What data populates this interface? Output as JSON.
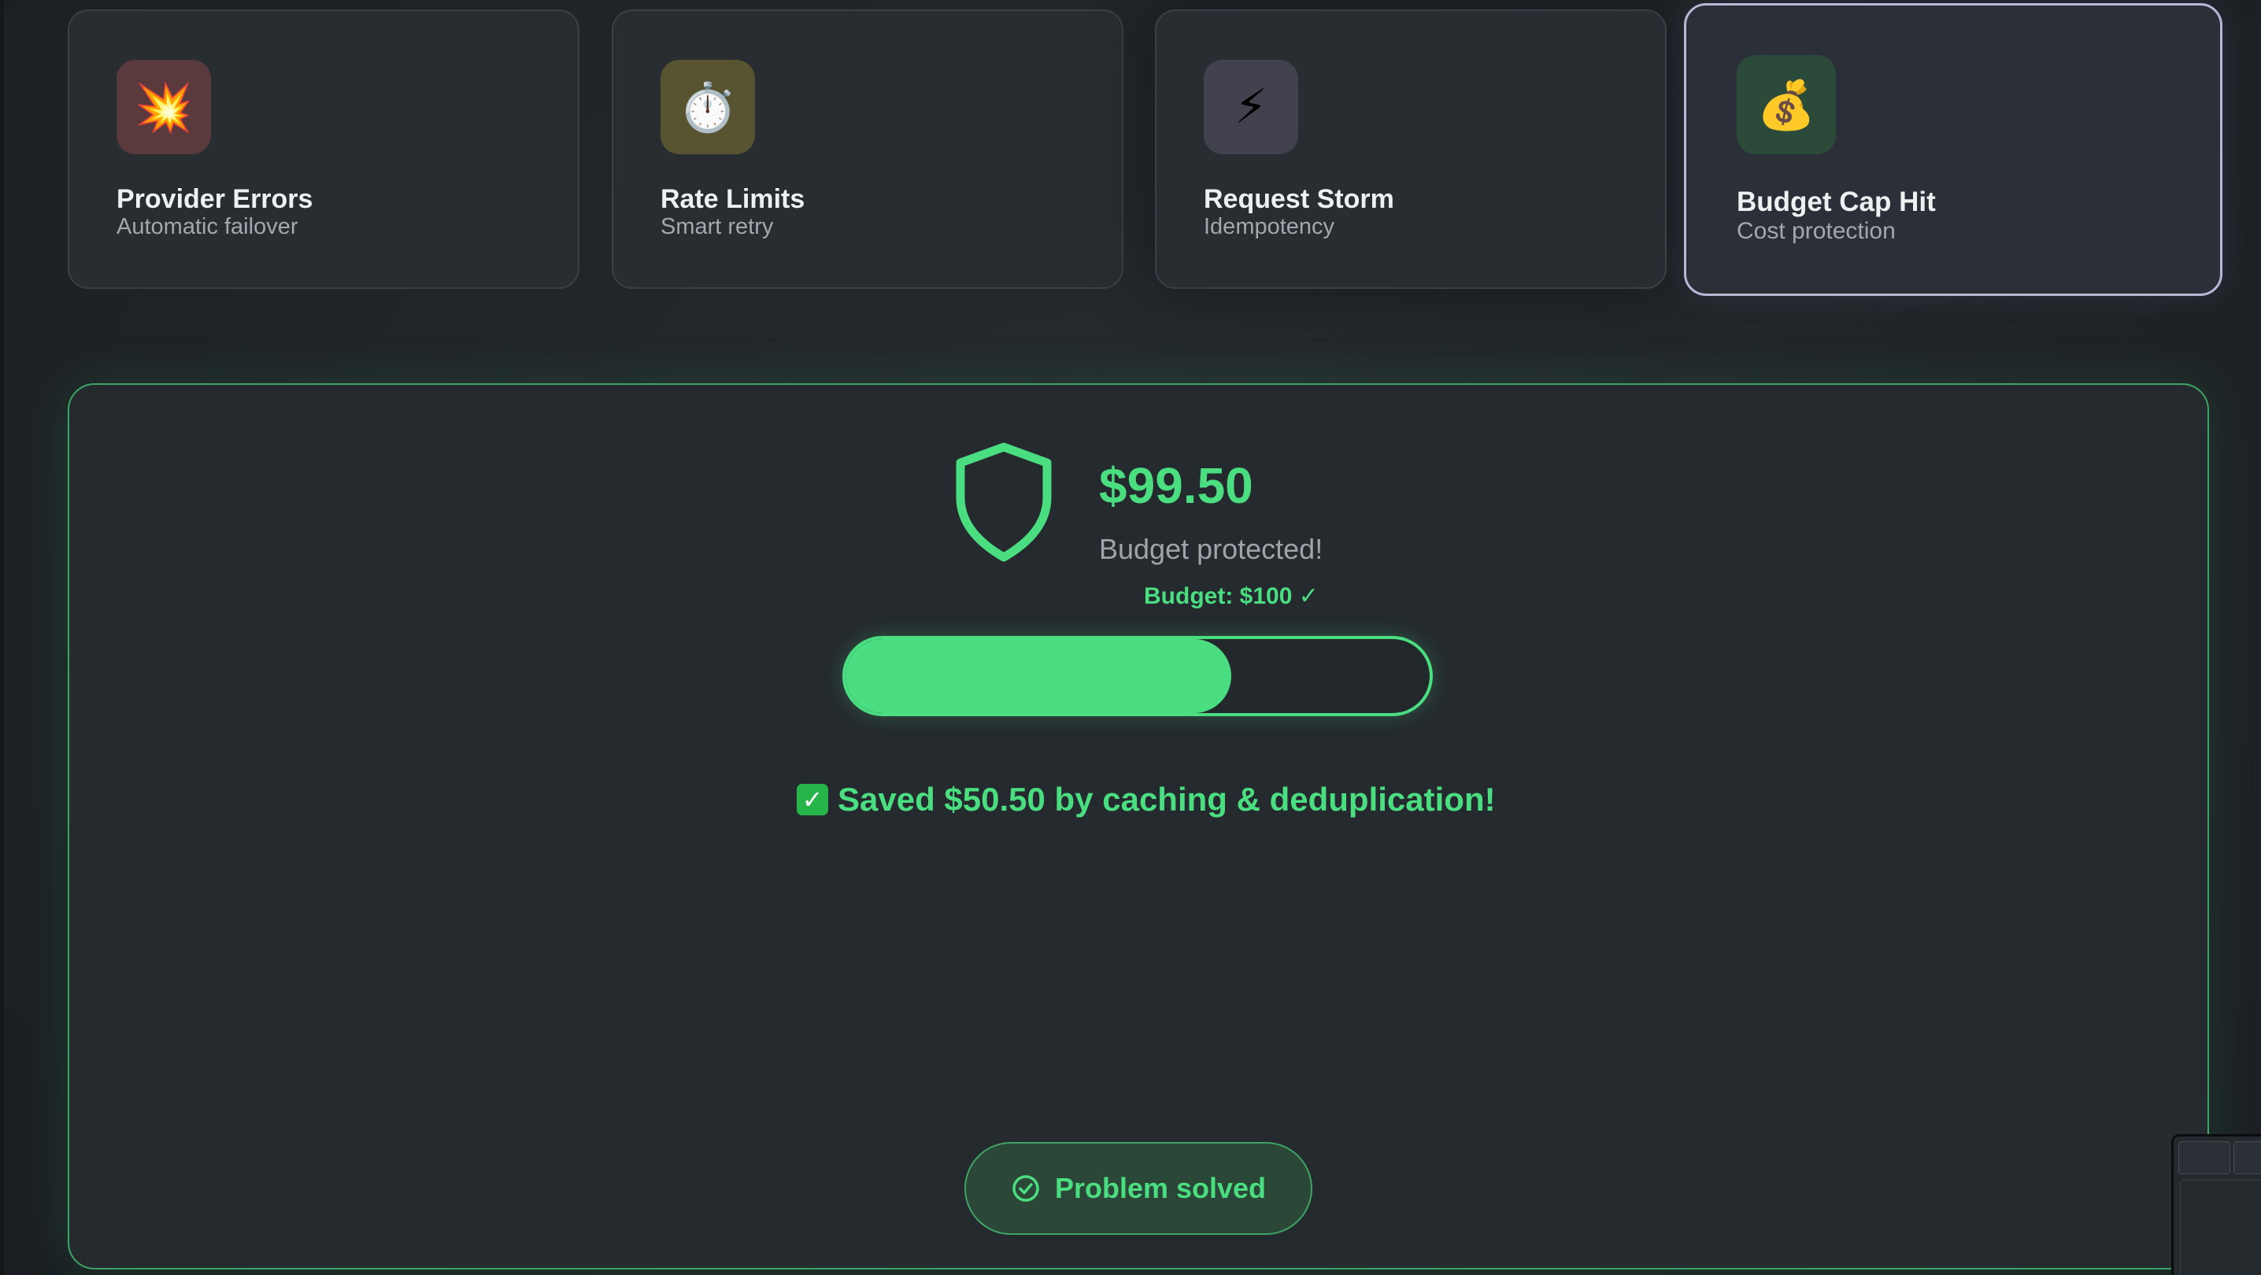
{
  "scenarios": [
    {
      "icon": "💥",
      "icon_name": "explosion-icon",
      "icon_bg": "#5a3a3d",
      "title": "Provider Errors",
      "subtitle": "Automatic failover"
    },
    {
      "icon": "⏱️",
      "icon_name": "stopwatch-icon",
      "icon_bg": "#585330",
      "title": "Rate Limits",
      "subtitle": "Smart retry"
    },
    {
      "icon": "⚡",
      "icon_name": "lightning-icon",
      "icon_bg": "#41424d",
      "title": "Request Storm",
      "subtitle": "Idempotency"
    },
    {
      "icon": "💰",
      "icon_name": "money-bag-icon",
      "icon_bg": "#2b4a3a",
      "title": "Budget Cap Hit",
      "subtitle": "Cost protection",
      "selected": true
    }
  ],
  "result": {
    "amount": "$99.50",
    "status": "Budget protected!",
    "budget_label": "Budget: $100 ✓",
    "progress_fraction": 0.66,
    "saved_icon": "✓",
    "saved_text": "Saved $50.50 by caching & deduplication!",
    "solved_label": "Problem solved"
  },
  "colors": {
    "accent": "#4ade80",
    "panel_border": "#3ea364",
    "selected_border": "#b6b8d6"
  }
}
